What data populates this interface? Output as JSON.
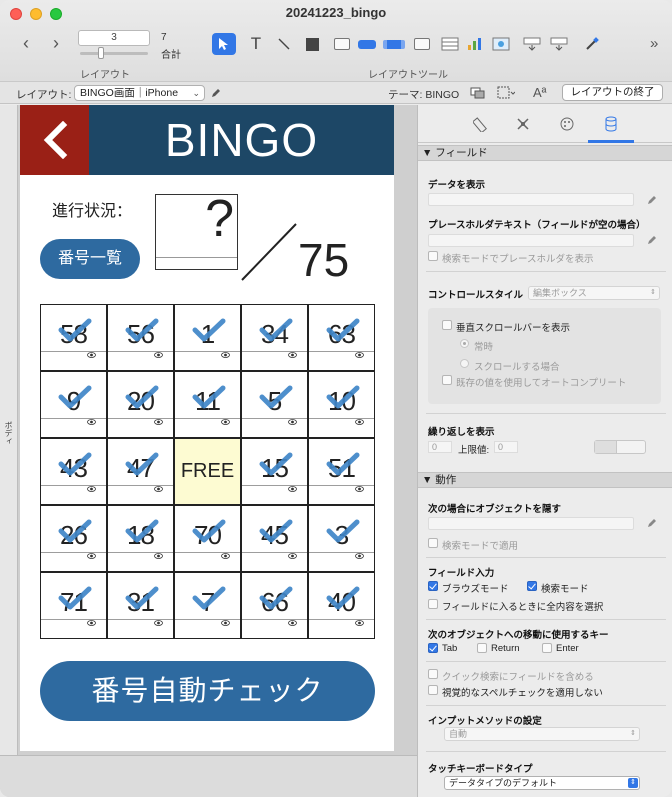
{
  "window": {
    "title": "20241223_bingo"
  },
  "toolbar": {
    "record_value": "3",
    "record_count": "7",
    "record_total_label": "合計",
    "layout_label": "レイアウト",
    "layout_tools_label": "レイアウトツール"
  },
  "formatbar": {
    "layout_label": "レイアウト:",
    "layout_name": "BINGO画面｜iPhone",
    "theme_label": "テーマ: BINGO",
    "exit_layout_button": "レイアウトの終了"
  },
  "canvas": {
    "body_part_label": "ボディ"
  },
  "app": {
    "title": "BINGO",
    "progress_label": "進行状況：",
    "count_value": "?",
    "total": "75",
    "list_button": "番号一覧",
    "auto_check_button": "番号自動チェック",
    "grid": [
      {
        "num": "58",
        "checked": true
      },
      {
        "num": "56",
        "checked": true
      },
      {
        "num": "1",
        "checked": true
      },
      {
        "num": "34",
        "checked": true
      },
      {
        "num": "63",
        "checked": true
      },
      {
        "num": "9",
        "checked": true
      },
      {
        "num": "20",
        "checked": true
      },
      {
        "num": "11",
        "checked": true
      },
      {
        "num": "5",
        "checked": true
      },
      {
        "num": "10",
        "checked": true
      },
      {
        "num": "43",
        "checked": true
      },
      {
        "num": "47",
        "checked": true
      },
      {
        "num": "FREE",
        "checked": false,
        "free": true
      },
      {
        "num": "15",
        "checked": true
      },
      {
        "num": "51",
        "checked": true
      },
      {
        "num": "26",
        "checked": true
      },
      {
        "num": "18",
        "checked": true
      },
      {
        "num": "70",
        "checked": true
      },
      {
        "num": "45",
        "checked": true
      },
      {
        "num": "3",
        "checked": true
      },
      {
        "num": "71",
        "checked": true
      },
      {
        "num": "31",
        "checked": true
      },
      {
        "num": "7",
        "checked": true
      },
      {
        "num": "66",
        "checked": true
      },
      {
        "num": "40",
        "checked": true
      }
    ]
  },
  "inspector": {
    "section_field": "▼ フィールド",
    "display_data": "データを表示",
    "placeholder_text": "プレースホルダテキスト（フィールドが空の場合）",
    "show_placeholder_find": "検索モードでプレースホルダを表示",
    "control_style": "コントロールスタイル",
    "control_style_value": "編集ボックス",
    "show_vscroll": "垂直スクロールバーを表示",
    "always": "常時",
    "when_scrolling": "スクロールする場合",
    "autocomplete": "既存の値を使用してオートコンプリート",
    "repeat_display": "繰り返しを表示",
    "repeat_start": "0",
    "repeat_max_label": "上限値:",
    "repeat_max": "0",
    "section_behavior": "▼ 動作",
    "hide_object_when": "次の場合にオブジェクトを隠す",
    "apply_in_find": "検索モードで適用",
    "field_entry": "フィールド入力",
    "browse_mode": "ブラウズモード",
    "find_mode": "検索モード",
    "select_all_on_enter": "フィールドに入るときに全内容を選択",
    "goto_next_key": "次のオブジェクトへの移動に使用するキー",
    "key_tab": "Tab",
    "key_return": "Return",
    "key_enter": "Enter",
    "include_quick_find": "クイック検索にフィールドを含める",
    "no_spellcheck": "視覚的なスペルチェックを適用しない",
    "input_method": "インプットメソッドの設定",
    "input_method_value": "自動",
    "touch_keyboard": "タッチキーボードタイプ",
    "touch_keyboard_value": "データタイプのデフォルト"
  }
}
